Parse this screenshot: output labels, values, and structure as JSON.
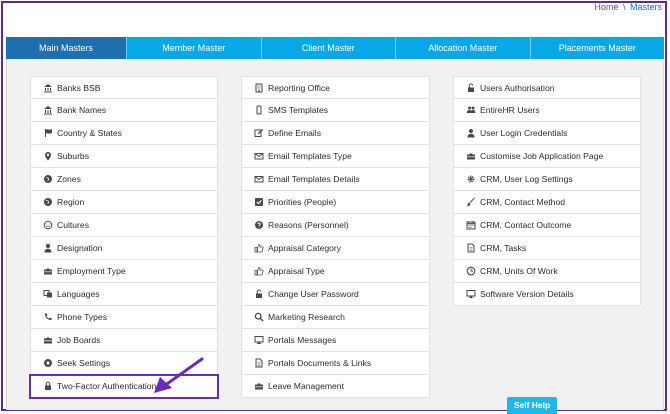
{
  "breadcrumb": {
    "home": "Home",
    "separator": "\\",
    "current": "Masters"
  },
  "tabs": [
    {
      "label": "Main Masters",
      "active": true
    },
    {
      "label": "Member Master",
      "active": false
    },
    {
      "label": "Client Master",
      "active": false
    },
    {
      "label": "Allocation Master",
      "active": false
    },
    {
      "label": "Placements Master",
      "active": false
    }
  ],
  "columns": [
    [
      {
        "label": "Banks BSB",
        "icon": "bank-icon"
      },
      {
        "label": "Bank Names",
        "icon": "bank-icon"
      },
      {
        "label": "Country & States",
        "icon": "flag-icon"
      },
      {
        "label": "Suburbs",
        "icon": "map-marker-icon"
      },
      {
        "label": "Zones",
        "icon": "globe-icon"
      },
      {
        "label": "Region",
        "icon": "globe-icon"
      },
      {
        "label": "Cultures",
        "icon": "smile-icon"
      },
      {
        "label": "Designation",
        "icon": "user-icon"
      },
      {
        "label": "Employment Type",
        "icon": "briefcase-icon"
      },
      {
        "label": "Languages",
        "icon": "language-icon"
      },
      {
        "label": "Phone Types",
        "icon": "phone-icon"
      },
      {
        "label": "Job Boards",
        "icon": "briefcase-icon"
      },
      {
        "label": "Seek Settings",
        "icon": "seek-icon"
      },
      {
        "label": "Two-Factor Authentication",
        "icon": "lock-icon"
      }
    ],
    [
      {
        "label": "Reporting Office",
        "icon": "building-icon"
      },
      {
        "label": "SMS Templates",
        "icon": "mobile-icon"
      },
      {
        "label": "Define Emails",
        "icon": "edit-icon"
      },
      {
        "label": "Email Templates Type",
        "icon": "envelope-icon"
      },
      {
        "label": "Email Templates Details",
        "icon": "envelope-icon"
      },
      {
        "label": "Priorities (People)",
        "icon": "check-square-icon"
      },
      {
        "label": "Reasons (Personnel)",
        "icon": "question-circle-icon"
      },
      {
        "label": "Appraisal Category",
        "icon": "thumbs-up-icon"
      },
      {
        "label": "Appraisal Type",
        "icon": "thumbs-up-icon"
      },
      {
        "label": "Change User Password",
        "icon": "unlock-icon"
      },
      {
        "label": "Marketing Research",
        "icon": "search-icon"
      },
      {
        "label": "Portals Messages",
        "icon": "desktop-icon"
      },
      {
        "label": "Portals Documents & Links",
        "icon": "file-icon"
      },
      {
        "label": "Leave Management",
        "icon": "briefcase-icon"
      }
    ],
    [
      {
        "label": "Users Authorisation",
        "icon": "unlock-icon"
      },
      {
        "label": "EntireHR Users",
        "icon": "users-icon"
      },
      {
        "label": "User Login Credentials",
        "icon": "user-icon"
      },
      {
        "label": "Customise Job Application Page",
        "icon": "briefcase-icon"
      },
      {
        "label": "CRM, User Log Settings",
        "icon": "gear-icon"
      },
      {
        "label": "CRM, Contact Method",
        "icon": "brush-icon"
      },
      {
        "label": "CRM, Contact Outcome",
        "icon": "calendar-icon"
      },
      {
        "label": "CRM, Tasks",
        "icon": "file-icon"
      },
      {
        "label": "CRM, Units Of Work",
        "icon": "clock-icon"
      },
      {
        "label": "Software Version Details",
        "icon": "desktop-icon"
      }
    ]
  ],
  "self_help": "Self Help",
  "colors": {
    "tab_bar": "#08a8e6",
    "tab_active": "#1d6fad",
    "annotation": "#6a2bb8"
  }
}
